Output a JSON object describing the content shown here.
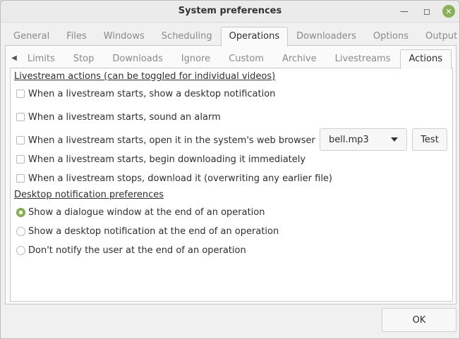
{
  "window": {
    "title": "System preferences"
  },
  "top_tabs": [
    "General",
    "Files",
    "Windows",
    "Scheduling",
    "Operations",
    "Downloaders",
    "Options",
    "Output"
  ],
  "active_top_tab": "Operations",
  "sub_tabs": [
    "Limits",
    "Stop",
    "Downloads",
    "Ignore",
    "Custom",
    "Archive",
    "Livestreams",
    "Actions"
  ],
  "active_sub_tab": "Actions",
  "livestream_section": {
    "heading": "Livestream actions (can be toggled for individual videos)",
    "options": [
      {
        "label": "When a livestream starts, show a desktop notification",
        "checked": false
      },
      {
        "label": "When a livestream starts, sound an alarm",
        "checked": false
      },
      {
        "label": "When a livestream starts, open it in the system's web browser",
        "checked": false
      },
      {
        "label": "When a livestream starts, begin downloading it immediately",
        "checked": false
      },
      {
        "label": "When a livestream stops, download it (overwriting any earlier file)",
        "checked": false
      }
    ],
    "alarm_sound": "bell.mp3",
    "test_label": "Test"
  },
  "notification_section": {
    "heading": "Desktop notification preferences",
    "options": [
      {
        "label": "Show a dialogue window at the end of an operation",
        "selected": true
      },
      {
        "label": "Show a desktop notification at the end of an operation",
        "selected": false
      },
      {
        "label": "Don't notify the user at the end of an operation",
        "selected": false
      }
    ]
  },
  "footer": {
    "ok_label": "OK"
  },
  "colors": {
    "accent": "#8bb158"
  }
}
